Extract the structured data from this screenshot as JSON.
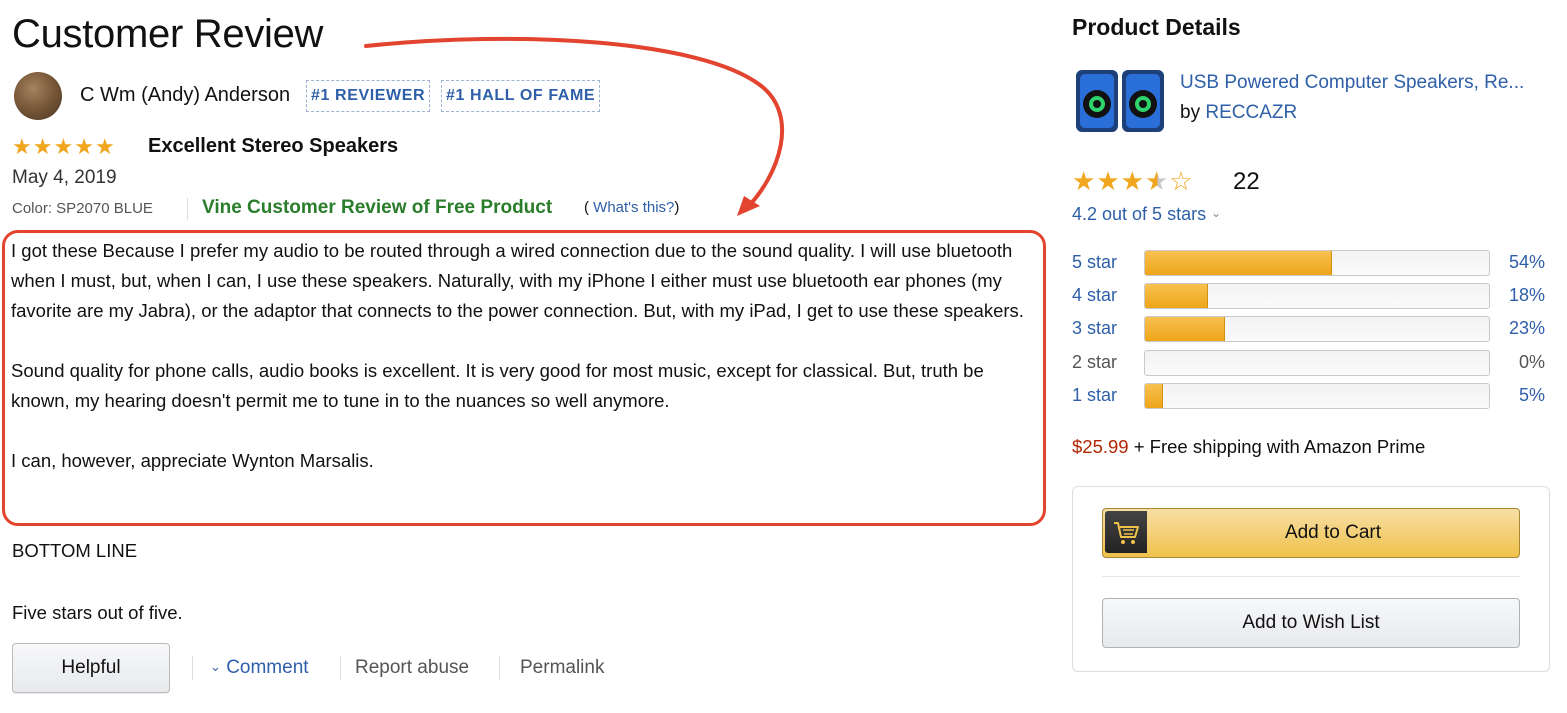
{
  "review": {
    "page_title": "Customer Review",
    "reviewer": {
      "name": "C Wm (Andy) Anderson",
      "badges": [
        "#1 REVIEWER",
        "#1 HALL OF FAME"
      ]
    },
    "rating_stars": 5,
    "title": "Excellent Stereo Speakers",
    "date": "May 4, 2019",
    "color_option": "Color: SP2070 BLUE",
    "vine_label": "Vine Customer Review of Free Product",
    "whats_this_open": "(",
    "whats_this_link": "What's this?",
    "whats_this_close": ")",
    "body": [
      "I got these Because I prefer my audio to be routed through a wired connection due to the sound quality. I will use bluetooth when I must, but, when I can, I use these speakers. Naturally, with my iPhone I either must use bluetooth ear phones (my favorite are my Jabra), or the adaptor that connects to the power connection. But, with my iPad, I get to use these speakers.",
      "Sound quality for phone calls, audio books is excellent. It is very good for most music, except for classical. But, truth be known, my hearing doesn't permit me to tune in to the nuances so well anymore.",
      "I can, however, appreciate Wynton Marsalis."
    ],
    "bottom_line": "BOTTOM LINE",
    "verdict": "Five stars out of five.",
    "actions": {
      "helpful": "Helpful",
      "comment": "Comment",
      "report_abuse": "Report abuse",
      "permalink": "Permalink"
    },
    "highlight_color": "#e2442f"
  },
  "product": {
    "section_title": "Product Details",
    "title": "USB Powered Computer Speakers, Re...",
    "by_prefix": "by",
    "brand": "RECCAZR",
    "average_stars": 4.2,
    "rating_count": "22",
    "rating_summary": "4.2 out of 5 stars",
    "histogram": [
      {
        "label": "5 star",
        "percent_label": "54%",
        "fraction": 0.54
      },
      {
        "label": "4 star",
        "percent_label": "18%",
        "fraction": 0.18
      },
      {
        "label": "3 star",
        "percent_label": "23%",
        "fraction": 0.23
      },
      {
        "label": "2 star",
        "percent_label": "0%",
        "fraction": 0.0
      },
      {
        "label": "1 star",
        "percent_label": "5%",
        "fraction": 0.05
      }
    ],
    "price": "$25.99",
    "shipping": "+ Free shipping with Amazon Prime",
    "buttons": {
      "add_to_cart": "Add to Cart",
      "add_to_wish_list": "Add to Wish List"
    }
  },
  "icons": {
    "star": "star-icon",
    "chevron": "chevron-down-icon",
    "cart": "cart-icon"
  },
  "colors": {
    "link": "#2e5fa8",
    "star": "#f0a61e",
    "vine": "#2a7d2a",
    "price": "#b12704"
  }
}
